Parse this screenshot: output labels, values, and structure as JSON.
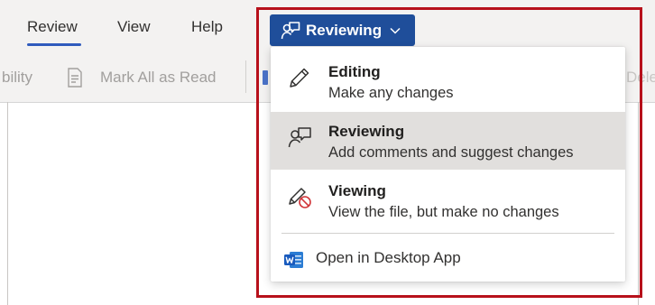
{
  "ribbon": {
    "tabs": [
      {
        "label": "Review",
        "active": true
      },
      {
        "label": "View",
        "active": false
      },
      {
        "label": "Help",
        "active": false
      }
    ],
    "commands": {
      "accessibility_fragment": "bility",
      "mark_all_read": "Mark All as Read",
      "right_fragment": "Dele"
    }
  },
  "mode_button": {
    "label": "Reviewing",
    "icon": "reviewing-icon",
    "color": "#1f4e9a"
  },
  "menu": {
    "items": [
      {
        "title": "Editing",
        "description": "Make any changes",
        "icon": "pencil-icon",
        "selected": false
      },
      {
        "title": "Reviewing",
        "description": "Add comments and suggest changes",
        "icon": "reviewing-icon",
        "selected": true
      },
      {
        "title": "Viewing",
        "description": "View the file, but make no changes",
        "icon": "pencil-prohibited-icon",
        "selected": false
      }
    ],
    "open_desktop": {
      "label": "Open in Desktop App",
      "icon": "word-icon"
    }
  },
  "highlight_color": "#b7111b"
}
